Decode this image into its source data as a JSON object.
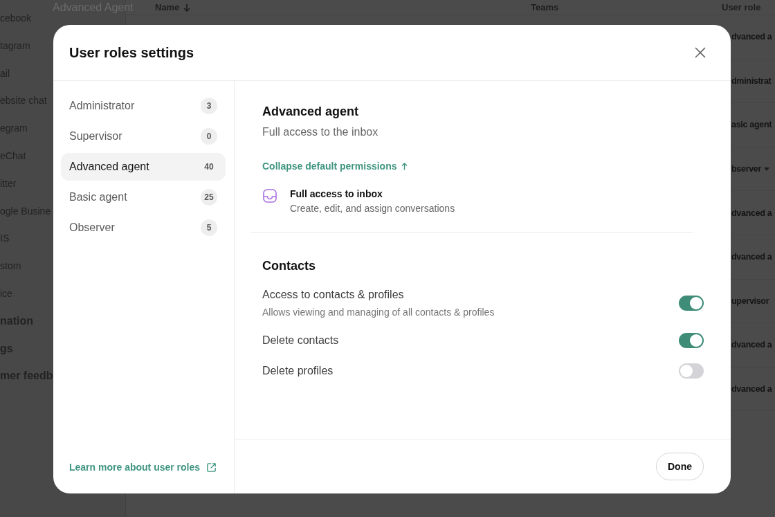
{
  "background": {
    "page_title": "Advanced Agent",
    "sidebar_items": [
      {
        "label": "cebook",
        "kind": "item"
      },
      {
        "label": "tagram",
        "kind": "item"
      },
      {
        "label": "ail",
        "kind": "item"
      },
      {
        "label": "ebsite chat",
        "kind": "item"
      },
      {
        "label": "egram",
        "kind": "item"
      },
      {
        "label": "eChat",
        "kind": "item"
      },
      {
        "label": "itter",
        "kind": "item"
      },
      {
        "label": "ogle Busine",
        "kind": "item"
      },
      {
        "label": "IS",
        "kind": "item"
      },
      {
        "label": "stom",
        "kind": "item"
      },
      {
        "label": "ice",
        "kind": "item"
      },
      {
        "label": "nation",
        "kind": "heading"
      },
      {
        "label": "gs",
        "kind": "heading"
      },
      {
        "label": "mer feedb",
        "kind": "heading"
      }
    ],
    "table": {
      "columns": [
        "Name",
        "Teams",
        "User role"
      ],
      "user_roles": [
        {
          "text": "dvanced a",
          "dropdown": false
        },
        {
          "text": "dministrat",
          "dropdown": false
        },
        {
          "text": "asic agent",
          "dropdown": false
        },
        {
          "text": "bserver",
          "dropdown": true
        },
        {
          "text": "dvanced a",
          "dropdown": false
        },
        {
          "text": "dvanced a",
          "dropdown": false
        },
        {
          "text": "upervisor",
          "dropdown": false
        },
        {
          "text": "dvanced a",
          "dropdown": false
        },
        {
          "text": "dvanced a",
          "dropdown": false
        }
      ]
    }
  },
  "modal": {
    "title": "User roles settings",
    "roles": [
      {
        "name": "Administrator",
        "count": "3",
        "selected": false
      },
      {
        "name": "Supervisor",
        "count": "0",
        "selected": false
      },
      {
        "name": "Advanced agent",
        "count": "40",
        "selected": true
      },
      {
        "name": "Basic agent",
        "count": "25",
        "selected": false
      },
      {
        "name": "Observer",
        "count": "5",
        "selected": false
      }
    ],
    "learn_more_link": "Learn more about user roles",
    "role_detail": {
      "title": "Advanced agent",
      "subtitle": "Full access to the inbox",
      "collapse_link": "Collapse default permissions",
      "default_permissions": [
        {
          "title": "Full access to inbox",
          "description": "Create, edit, and assign conversations"
        }
      ]
    },
    "sections": [
      {
        "title": "Contacts",
        "permissions": [
          {
            "label": "Access to contacts & profiles",
            "description": "Allows viewing and managing of all contacts & profiles",
            "on": true
          },
          {
            "label": "Delete contacts",
            "on": true
          },
          {
            "label": "Delete profiles",
            "on": false
          }
        ]
      }
    ],
    "done_button": "Done"
  }
}
